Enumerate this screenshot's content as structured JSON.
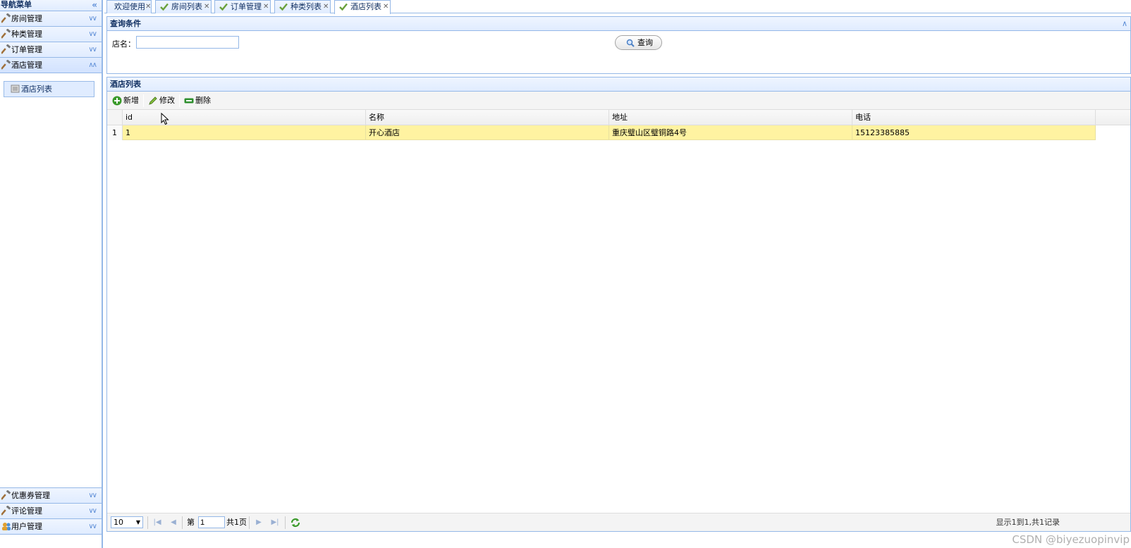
{
  "nav": {
    "title": "导航菜单",
    "collapse_icon": "double-chevron-left-icon",
    "sections_top": [
      {
        "label": "房间管理",
        "icon": "hammer-icon",
        "expanded": false
      },
      {
        "label": "种类管理",
        "icon": "hammer-icon",
        "expanded": false
      },
      {
        "label": "订单管理",
        "icon": "hammer-icon",
        "expanded": false
      },
      {
        "label": "酒店管理",
        "icon": "hammer-icon",
        "expanded": true
      }
    ],
    "active_section_items": [
      {
        "label": "酒店列表",
        "icon": "list-doc-icon"
      }
    ],
    "sections_bottom": [
      {
        "label": "优惠券管理",
        "icon": "hammer-icon"
      },
      {
        "label": "评论管理",
        "icon": "hammer-icon"
      },
      {
        "label": "用户管理",
        "icon": "users-icon"
      }
    ]
  },
  "tabs": [
    {
      "label": "欢迎使用",
      "checked": false,
      "selected": false
    },
    {
      "label": "房间列表",
      "checked": true,
      "selected": false
    },
    {
      "label": "订单管理",
      "checked": true,
      "selected": false
    },
    {
      "label": "种类列表",
      "checked": true,
      "selected": false
    },
    {
      "label": "酒店列表",
      "checked": true,
      "selected": true
    }
  ],
  "query_panel": {
    "title": "查询条件",
    "field_label": "店名：",
    "field_value": "",
    "search_button": "查询"
  },
  "list_panel": {
    "title": "酒店列表",
    "toolbar": {
      "add": "新增",
      "edit": "修改",
      "delete": "删除"
    },
    "columns": [
      "id",
      "名称",
      "地址",
      "电话"
    ],
    "rows": [
      {
        "rownum": "1",
        "cells": [
          "1",
          "开心酒店",
          "重庆璧山区璧铜路4号",
          "15123385885"
        ]
      }
    ],
    "pager": {
      "page_size": "10",
      "page_prefix": "第",
      "page_value": "1",
      "page_total": "共1页",
      "summary": "显示1到1,共1记录"
    }
  },
  "watermark": "CSDN @biyezuopinvip",
  "colors": {
    "accent_border": "#95b8e7",
    "header_bg": "#e0ecff",
    "selected_row": "#fff3a1",
    "title_text": "#0e2d5f"
  }
}
